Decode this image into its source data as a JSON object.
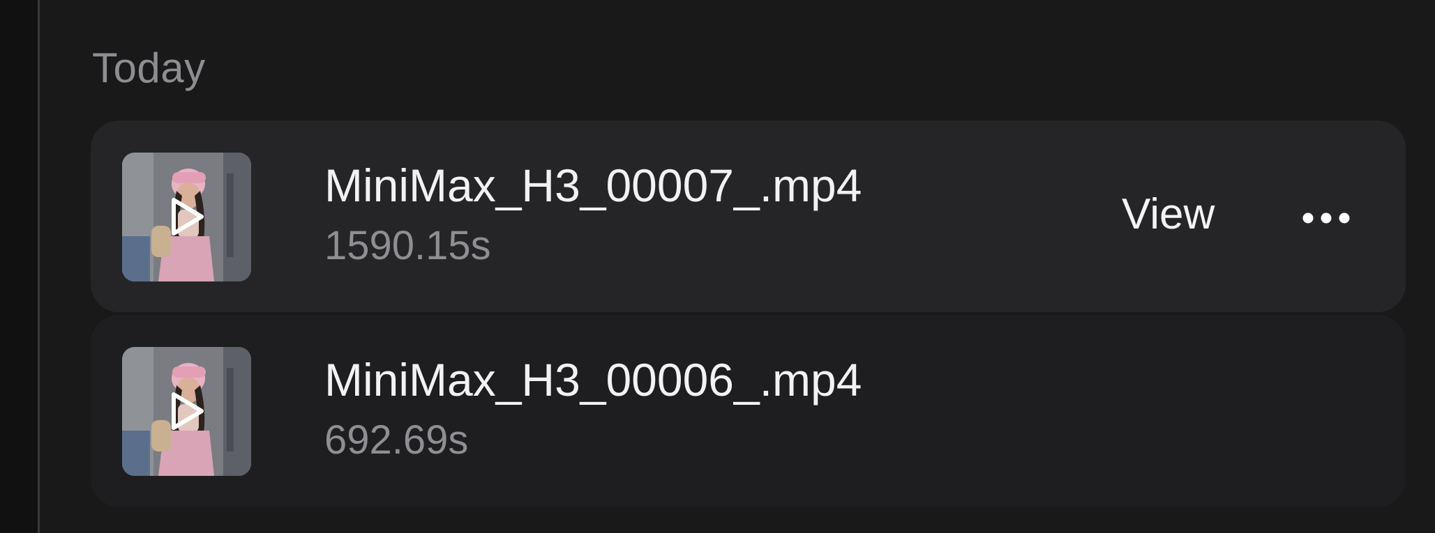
{
  "section": {
    "title": "Today"
  },
  "items": [
    {
      "file_name": "MiniMax_H3_00007_.mp4",
      "duration": "1590.15s",
      "view_label": "View",
      "selected": true
    },
    {
      "file_name": "MiniMax_H3_00006_.mp4",
      "duration": "692.69s",
      "selected": false
    }
  ],
  "icons": {
    "play": "play-icon",
    "more": "more-horizontal-icon"
  },
  "colors": {
    "background": "#19191a",
    "row_selected": "#252527",
    "row_normal": "#1e1e20",
    "text_primary": "#f2f2f4",
    "text_secondary": "#8e8e93"
  }
}
